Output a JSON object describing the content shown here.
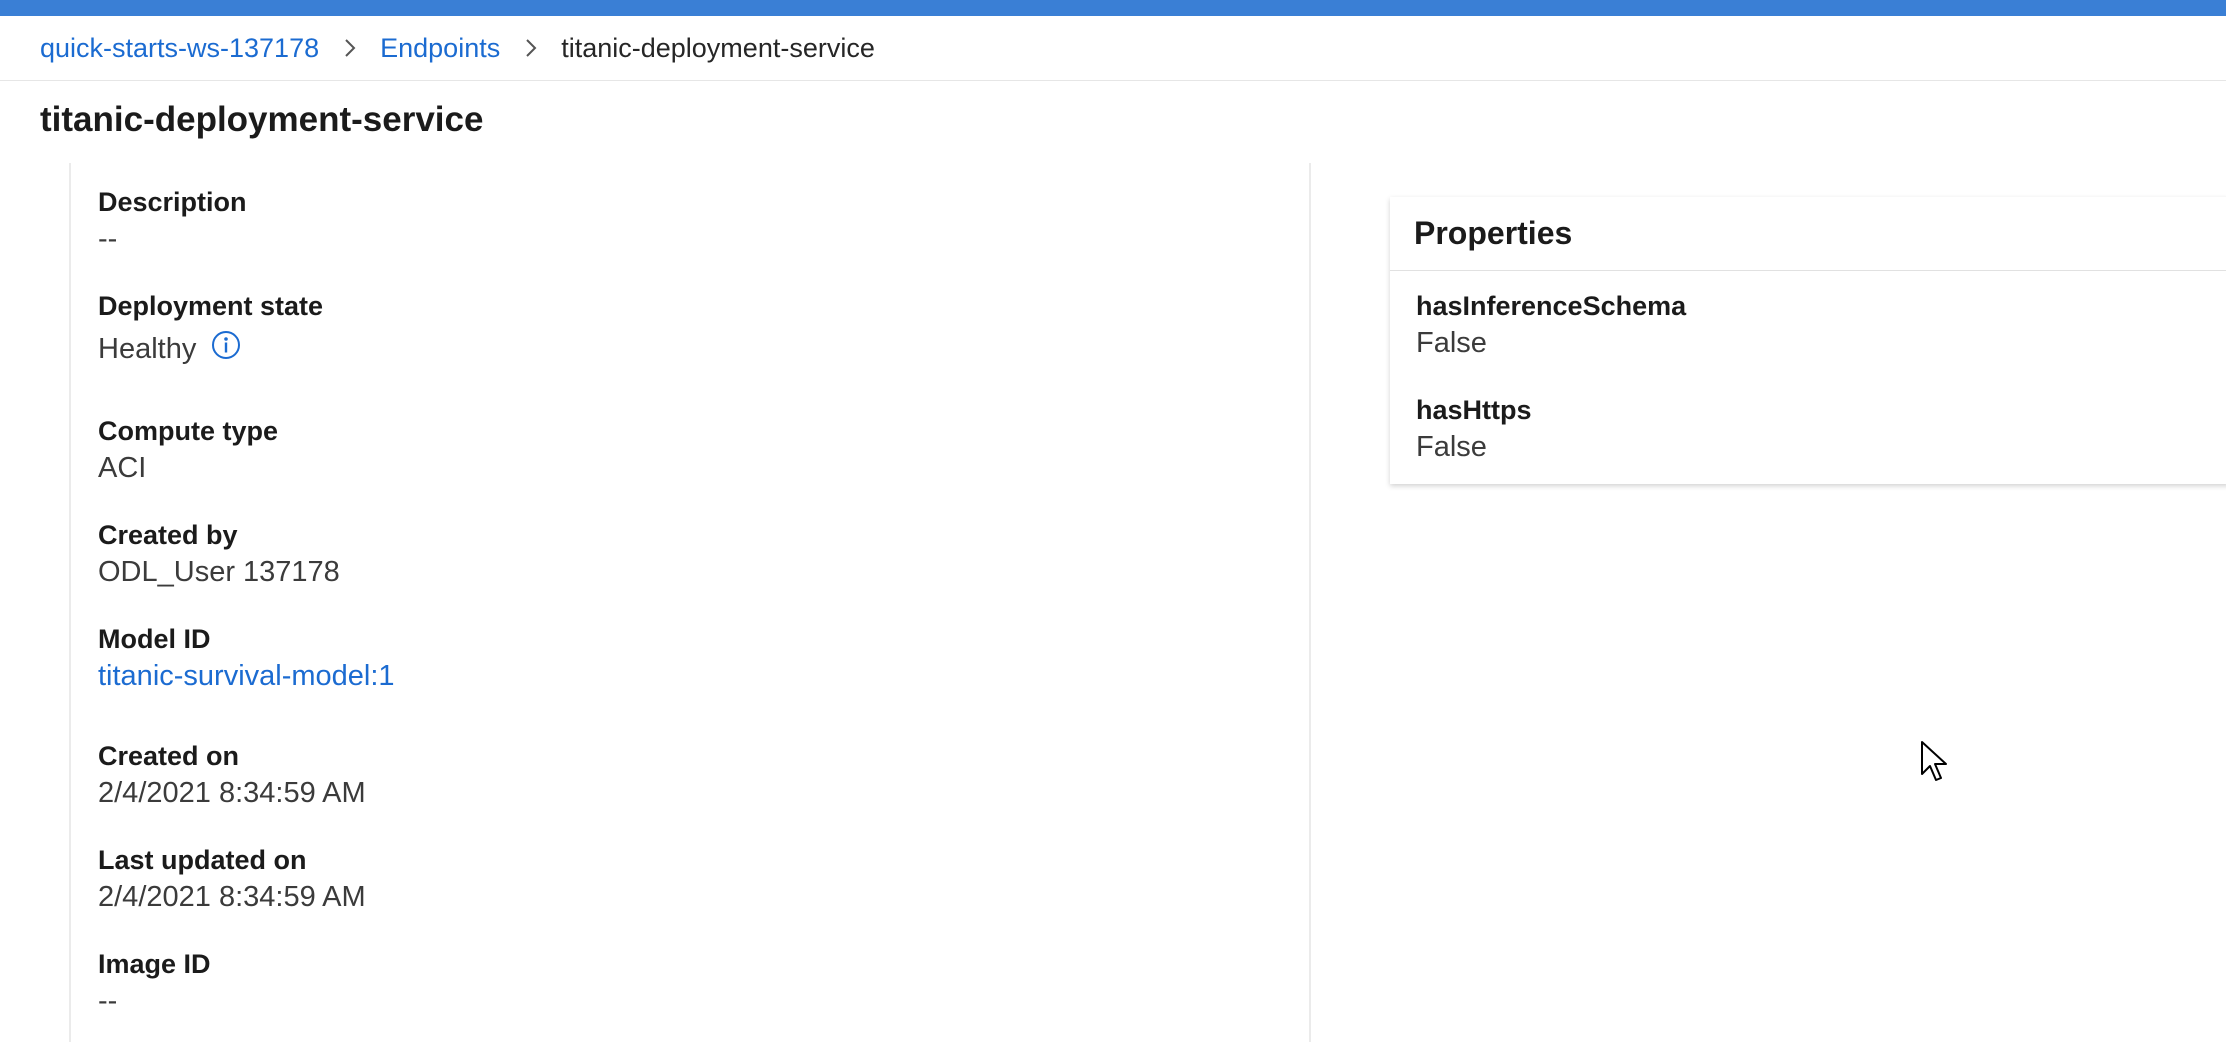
{
  "breadcrumb": {
    "workspace": "quick-starts-ws-137178",
    "endpoints": "Endpoints",
    "current": "titanic-deployment-service"
  },
  "page": {
    "title": "titanic-deployment-service"
  },
  "details": [
    {
      "label": "Description",
      "value": "--"
    },
    {
      "label": "Deployment state",
      "value": "Healthy"
    },
    {
      "label": "Compute type",
      "value": "ACI"
    },
    {
      "label": "Created by",
      "value": "ODL_User 137178"
    },
    {
      "label": "Model ID",
      "value": "titanic-survival-model:1"
    },
    {
      "label": "Created on",
      "value": "2/4/2021 8:34:59 AM"
    },
    {
      "label": "Last updated on",
      "value": "2/4/2021 8:34:59 AM"
    },
    {
      "label": "Image ID",
      "value": "--"
    }
  ],
  "properties": {
    "title": "Properties",
    "items": [
      {
        "key": "hasInferenceSchema",
        "value": "False"
      },
      {
        "key": "hasHttps",
        "value": "False"
      }
    ]
  },
  "icons": {
    "breadcrumb_separator": "chevron-right-icon",
    "deployment_state_info": "info-icon",
    "cursor": "mouse-pointer-icon"
  },
  "colors": {
    "top_bar": "#3a7fd5",
    "link": "#1b6bd1",
    "text": "#1b1b1b",
    "secondary_text": "#3b3b3b"
  }
}
